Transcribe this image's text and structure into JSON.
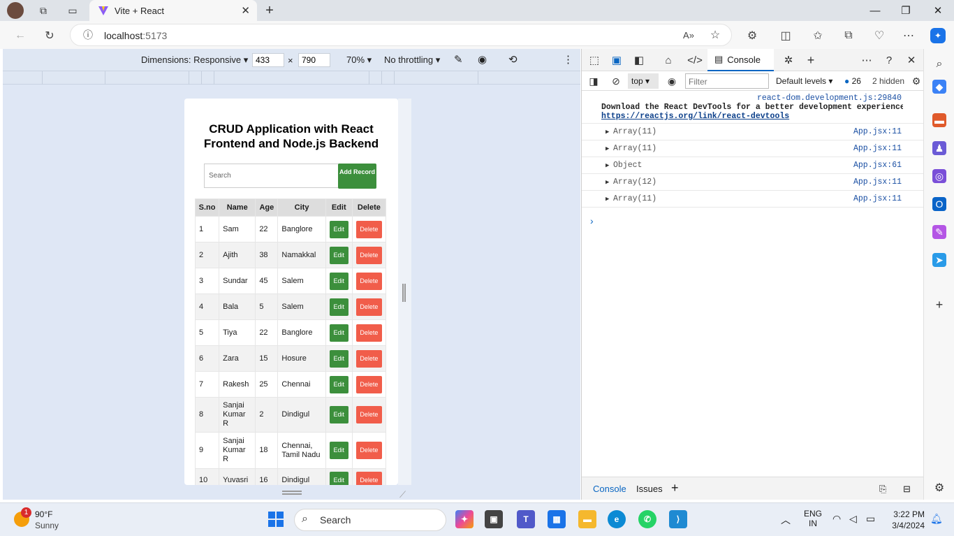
{
  "browser": {
    "tab_title": "Vite + React",
    "url_host": "localhost",
    "url_port": ":5173"
  },
  "device_toolbar": {
    "dimensions_label": "Dimensions: Responsive",
    "width": "433",
    "height": "790",
    "times": "×",
    "zoom": "70%",
    "throttling": "No throttling"
  },
  "app": {
    "title": "CRUD Application with React Frontend and Node.js Backend",
    "search_placeholder": "Search",
    "add_button": "Add Record",
    "columns": [
      "S.no",
      "Name",
      "Age",
      "City",
      "Edit",
      "Delete"
    ],
    "edit_label": "Edit",
    "delete_label": "Delete",
    "rows": [
      {
        "sno": "1",
        "name": "Sam",
        "age": "22",
        "city": "Banglore"
      },
      {
        "sno": "2",
        "name": "Ajith",
        "age": "38",
        "city": "Namakkal"
      },
      {
        "sno": "3",
        "name": "Sundar",
        "age": "45",
        "city": "Salem"
      },
      {
        "sno": "4",
        "name": "Bala",
        "age": "5",
        "city": "Salem"
      },
      {
        "sno": "5",
        "name": "Tiya",
        "age": "22",
        "city": "Banglore"
      },
      {
        "sno": "6",
        "name": "Zara",
        "age": "15",
        "city": "Hosure"
      },
      {
        "sno": "7",
        "name": "Rakesh",
        "age": "25",
        "city": "Chennai"
      },
      {
        "sno": "8",
        "name": "Sanjai Kumar R",
        "age": "2",
        "city": "Dindigul"
      },
      {
        "sno": "9",
        "name": "Sanjai Kumar R",
        "age": "18",
        "city": "Chennai, Tamil Nadu"
      },
      {
        "sno": "10",
        "name": "Yuvasri",
        "age": "16",
        "city": "Dindigul"
      }
    ]
  },
  "devtools": {
    "console_tab": "Console",
    "context": "top",
    "filter_placeholder": "Filter",
    "levels": "Default levels",
    "issue_count": "26",
    "hidden": "2 hidden",
    "message_source": "react-dom.development.js:29840",
    "message_text": "Download the React DevTools for a better development experience: h",
    "message_link": "https://reactjs.org/link/react-devtools",
    "logs": [
      {
        "value": "Array(11)",
        "source": "App.jsx:11"
      },
      {
        "value": "Array(11)",
        "source": "App.jsx:11"
      },
      {
        "value": "Object",
        "source": "App.jsx:61"
      },
      {
        "value": "Array(12)",
        "source": "App.jsx:11"
      },
      {
        "value": "Array(11)",
        "source": "App.jsx:11"
      }
    ],
    "drawer_console": "Console",
    "drawer_issues": "Issues"
  },
  "taskbar": {
    "weather_badge": "1",
    "temperature": "90°F",
    "condition": "Sunny",
    "search": "Search",
    "lang_1": "ENG",
    "lang_2": "IN",
    "time": "3:22 PM",
    "date": "3/4/2024"
  },
  "colors": {
    "edit_green": "#3c8f3c",
    "delete_red": "#f15d4a",
    "devtools_blue": "#0a66c2"
  }
}
